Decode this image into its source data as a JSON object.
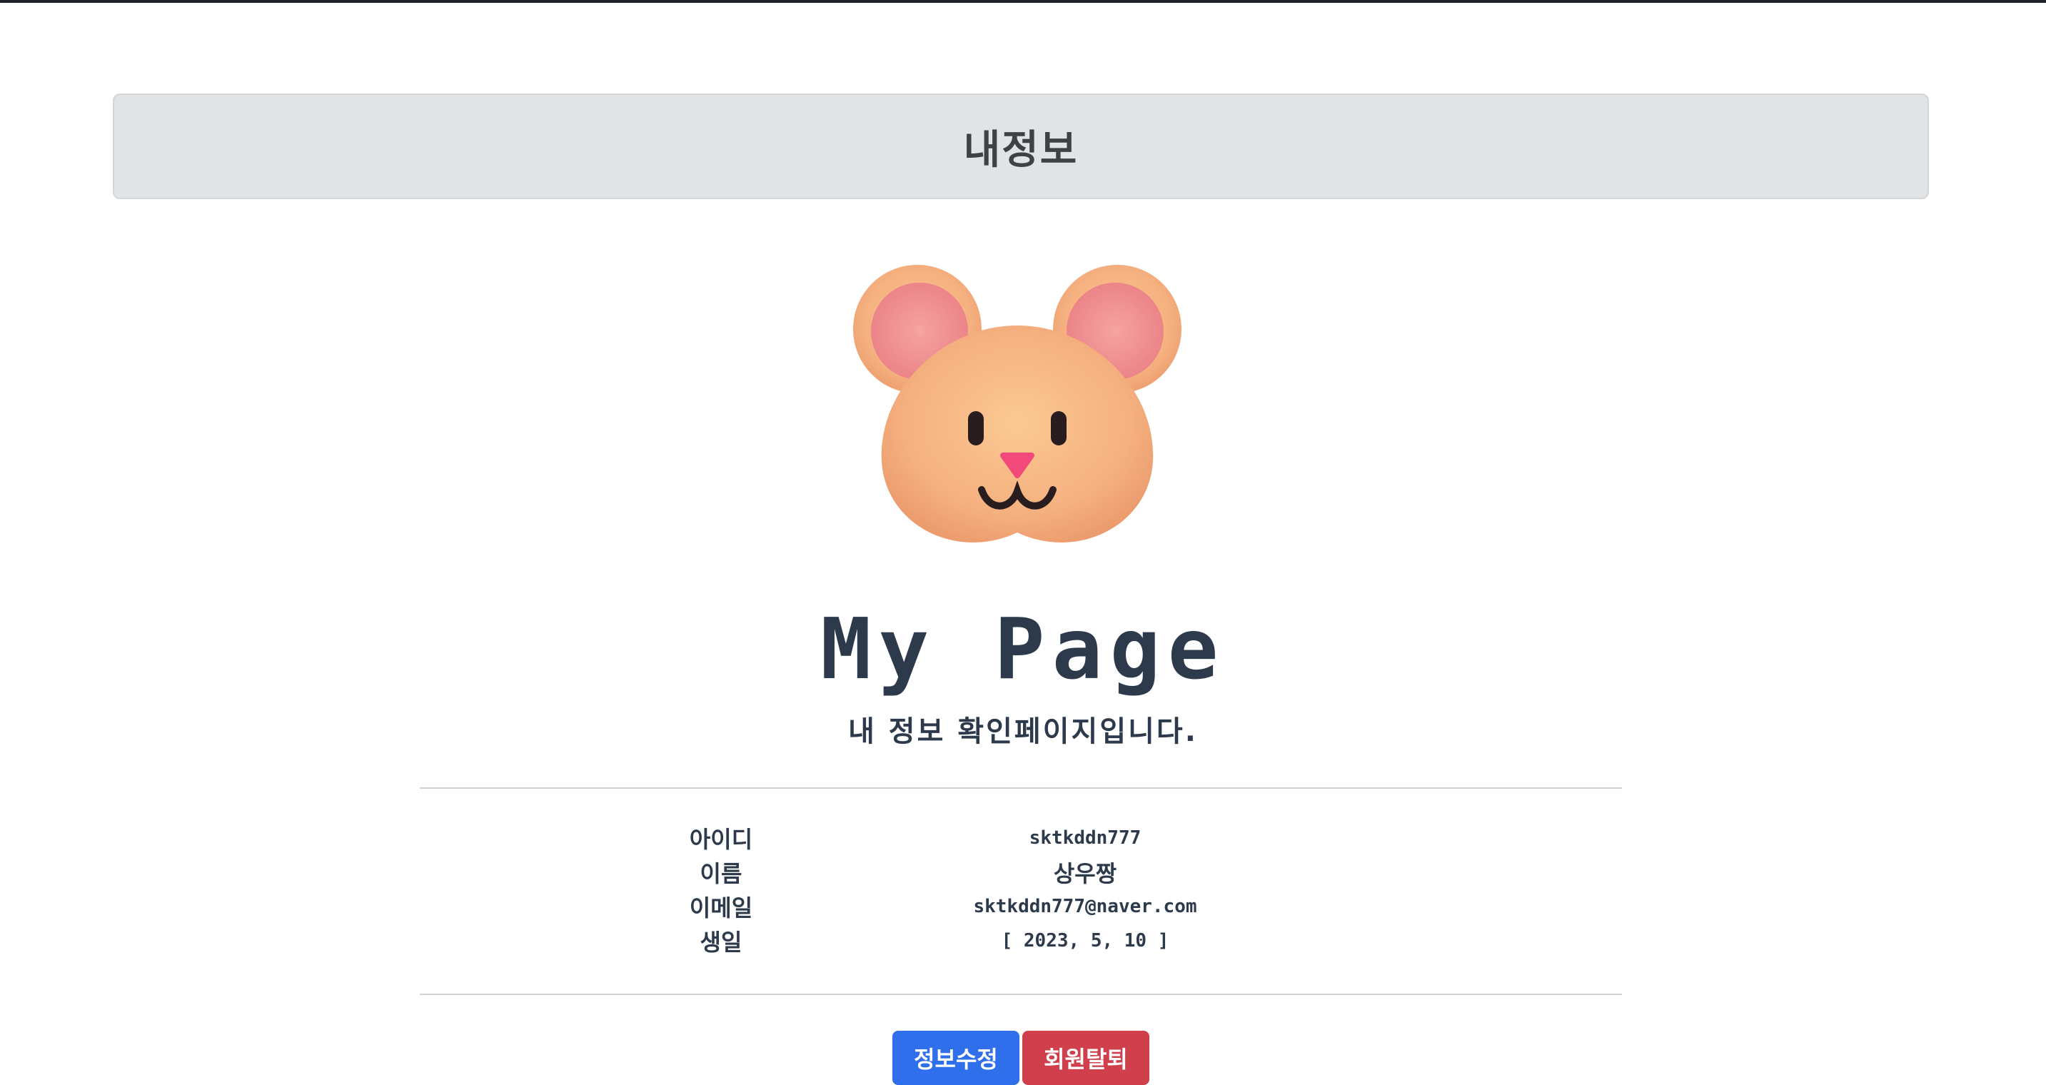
{
  "header": {
    "title": "내정보"
  },
  "avatar": {
    "icon": "hamster-face-icon"
  },
  "main": {
    "title": "My Page",
    "subtitle": "내 정보 확인페이지입니다."
  },
  "info": {
    "rows": [
      {
        "label": "아이디",
        "value": "sktkddn777"
      },
      {
        "label": "이름",
        "value": "상우짱"
      },
      {
        "label": "이메일",
        "value": "sktkddn777@naver.com"
      },
      {
        "label": "생일",
        "value": "[ 2023, 5, 10 ]"
      }
    ]
  },
  "actions": {
    "edit_label": "정보수정",
    "withdraw_label": "회원탈퇴"
  },
  "colors": {
    "edit_button": "#2f6fec",
    "withdraw_button": "#d0404c",
    "header_bg": "#e2e3e5"
  }
}
